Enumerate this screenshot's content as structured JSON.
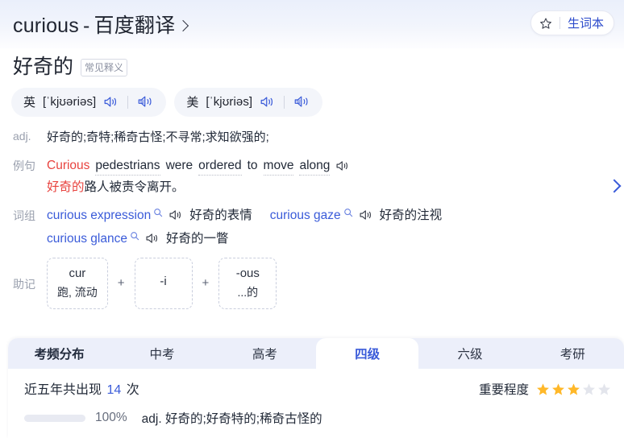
{
  "header": {
    "title_en": "curious",
    "dash": "-",
    "title_cn": "百度翻译",
    "chevron_icon": "chevron-right-icon",
    "vocab_button": {
      "label": "生词本",
      "icon": "star-outline-icon"
    }
  },
  "word": {
    "translation": "好奇的",
    "tag": "常见释义"
  },
  "phonetics": [
    {
      "lang": "英",
      "ipa": "[ˈkjʊəriəs]",
      "speak_icon": "speaker-icon",
      "slow_speak_icon": "slow-speaker-icon"
    },
    {
      "lang": "美",
      "ipa": "[ˈkjʊriəs]",
      "speak_icon": "speaker-icon",
      "slow_speak_icon": "slow-speaker-icon"
    }
  ],
  "definition": {
    "label": "adj.",
    "text": "好奇的;奇特;稀奇古怪;不寻常;求知欲强的;"
  },
  "example": {
    "label": "例句",
    "en_parts": [
      {
        "text": "Curious",
        "style": "highlight"
      },
      {
        "text": "pedestrians",
        "style": "underline"
      },
      {
        "text": "were",
        "style": "plain"
      },
      {
        "text": "ordered",
        "style": "underline"
      },
      {
        "text": "to",
        "style": "plain"
      },
      {
        "text": "move",
        "style": "underline"
      },
      {
        "text": "along",
        "style": "underline"
      }
    ],
    "en_plain": "Curious pedestrians were ordered to move along",
    "speak_icon": "speaker-icon",
    "cn_highlight": "好奇的",
    "cn_rest": "路人被责令离开。"
  },
  "phrases": {
    "label": "词组",
    "items": [
      {
        "en": "curious expression",
        "cn": "好奇的表情",
        "search_icon": "magnifier-icon",
        "speak_icon": "speaker-icon"
      },
      {
        "en": "curious gaze",
        "cn": "好奇的注视",
        "search_icon": "magnifier-icon",
        "speak_icon": "speaker-icon"
      },
      {
        "en": "curious glance",
        "cn": "好奇的一瞥",
        "search_icon": "magnifier-icon",
        "speak_icon": "speaker-icon"
      }
    ]
  },
  "mnemonic": {
    "label": "助记",
    "plus": "+",
    "parts": [
      {
        "root": "cur",
        "gloss": "跑, 流动"
      },
      {
        "root": "-i",
        "gloss": ""
      },
      {
        "root": "-ous",
        "gloss": "...的"
      }
    ]
  },
  "side_chevron_icon": "chevron-right-icon",
  "panel": {
    "tabs": [
      {
        "label": "考频分布",
        "type": "heading",
        "active": false
      },
      {
        "label": "中考",
        "type": "tab",
        "active": false
      },
      {
        "label": "高考",
        "type": "tab",
        "active": false
      },
      {
        "label": "四级",
        "type": "tab",
        "active": true
      },
      {
        "label": "六级",
        "type": "tab",
        "active": false
      },
      {
        "label": "考研",
        "type": "tab",
        "active": false
      }
    ],
    "frequency": {
      "prefix": "近五年共出现",
      "count": "14",
      "suffix": "次"
    },
    "importance": {
      "label": "重要程度",
      "filled": 3,
      "total": 5,
      "star_filled_icon": "star-filled-icon",
      "star_empty_icon": "star-empty-icon"
    },
    "distribution": [
      {
        "percent_label": "100%",
        "percent": 100,
        "definition": "adj. 好奇的;好奇特的;稀奇古怪的"
      }
    ]
  },
  "colors": {
    "accent_blue": "#3a5bd9",
    "bar_blue": "#4a6cf0",
    "highlight_red": "#e8433f",
    "star_gold": "#ffb829",
    "tabstrip_bg": "#eceffa"
  }
}
